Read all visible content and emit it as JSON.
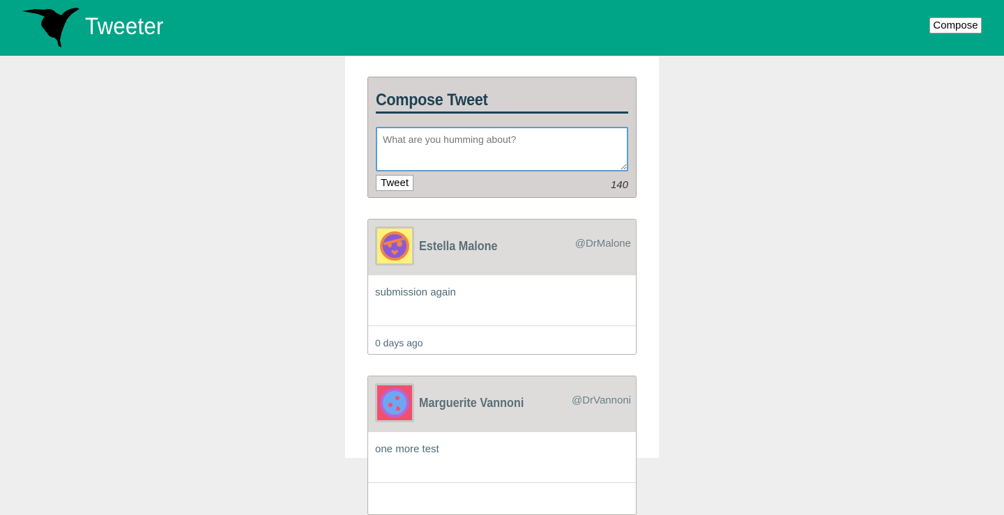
{
  "nav": {
    "brand": "Tweeter",
    "compose_label": "Compose",
    "logo_icon": "hummingbird-logo-icon"
  },
  "compose": {
    "title": "Compose Tweet",
    "placeholder": "What are you humming about?",
    "value": "",
    "submit_label": "Tweet",
    "char_count": "140"
  },
  "colors": {
    "nav_background": "#00a587",
    "page_background": "#eeeeee",
    "compose_background": "#d6d2d1",
    "title_color": "#1e4254",
    "name_color": "#5a6f77"
  },
  "tweets": [
    {
      "name": "Estella Malone",
      "handle": "@DrMalone",
      "content": "submission again",
      "time": "0 days ago",
      "avatar_icon": "pirate-face-avatar-icon"
    },
    {
      "name": "Marguerite Vannoni",
      "handle": "@DrVannoni",
      "content": "one more test",
      "time": "",
      "avatar_icon": "face-avatar-icon"
    }
  ]
}
